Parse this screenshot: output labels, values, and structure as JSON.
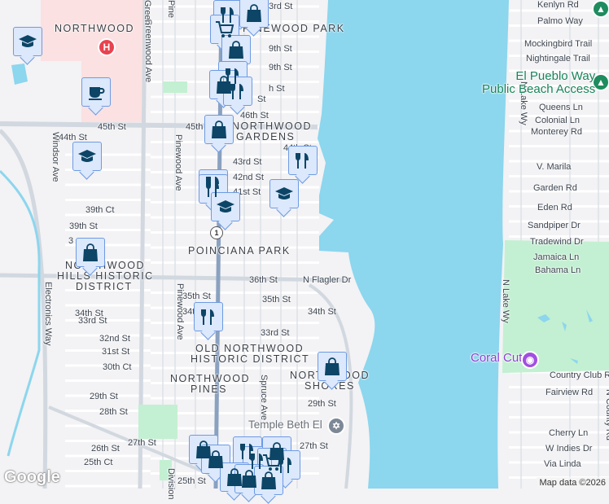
{
  "map": {
    "colors": {
      "water": "#8cd6ee",
      "land": "#f3f2f4",
      "park": "#c3f0d2",
      "hospital_area": "#fbe1e1",
      "road": "#ffffff",
      "major_road": "#d2d8e0",
      "us1": "#8aa1c0",
      "marker_fill": "#dce8fb",
      "marker_border": "#6d9be3",
      "icon": "#0c4566"
    },
    "neighborhoods": [
      "NORTHWOOD",
      "PINEWOOD PARK",
      "NORTHWOOD",
      "GARDENS",
      "POINCIANA PARK",
      "NORTHWOOD",
      "HILLS HISTORIC",
      "DISTRICT",
      "OLD NORTHWOOD",
      "HISTORIC DISTRICT",
      "NORTHWOOD",
      "PINES",
      "NORTHWOOD",
      "SHORES"
    ],
    "streets": [
      "3rd St",
      "9th St",
      "9th St",
      "h St",
      "St",
      "46th St",
      "45th St",
      "45th St",
      "44th St",
      "44th St",
      "43rd St",
      "42nd St",
      "41st St",
      "39th Ct",
      "39th St",
      "3",
      "36th St",
      "N Flagler Dr",
      "35th St",
      "35th St",
      "34t",
      "34th St",
      "34th St",
      "33rd St",
      "33rd St",
      "32nd St",
      "31st St",
      "30th Ct",
      "29th St",
      "29th St",
      "28th St",
      "27th St",
      "27th St",
      "26th St",
      "25th Ct",
      "25th St",
      "Windsor Ave",
      "Greenwood Ave",
      "Green",
      "Pinewood Ave",
      "Pine",
      "Pinewood Ave",
      "Electronics Way",
      "Spruce Ave",
      "Division",
      "Kenlyn Rd",
      "Palmo Way",
      "Mockingbird Trail",
      "Nightingale Trail",
      "Queens Ln",
      "Colonial Ln",
      "Monterey Rd",
      "V. Marila",
      "Garden Rd",
      "Eden Rd",
      "Sandpiper Dr",
      "Tradewind Dr",
      "Jamaica Ln",
      "Bahama Ln",
      "N Lake Wy",
      "N Lake Wy",
      "Country Club Rd",
      "Fairview Rd",
      "N County Rd",
      "Cherry Ln",
      "W Indies Dr",
      "Via Linda"
    ],
    "places": {
      "beach": "El Pueblo Way\nPublic Beach Access",
      "coral": "Coral Cut",
      "temple": "Temple Beth El",
      "hospital_icon": "H",
      "route_shield": "1"
    },
    "markers": [
      "restaurant",
      "shopping",
      "shopping-cart",
      "shopping",
      "restaurant",
      "shopping",
      "restaurant",
      "shopping",
      "restaurant",
      "restaurant",
      "restaurant",
      "school",
      "school",
      "school",
      "cafe",
      "school",
      "shopping",
      "restaurant",
      "shopping",
      "shopping",
      "shopping",
      "restaurant",
      "restaurant",
      "shopping",
      "shopping-cart",
      "restaurant",
      "shopping",
      "shopping",
      "shopping"
    ],
    "logo": "Google",
    "attribution": "Map data ©2026"
  }
}
